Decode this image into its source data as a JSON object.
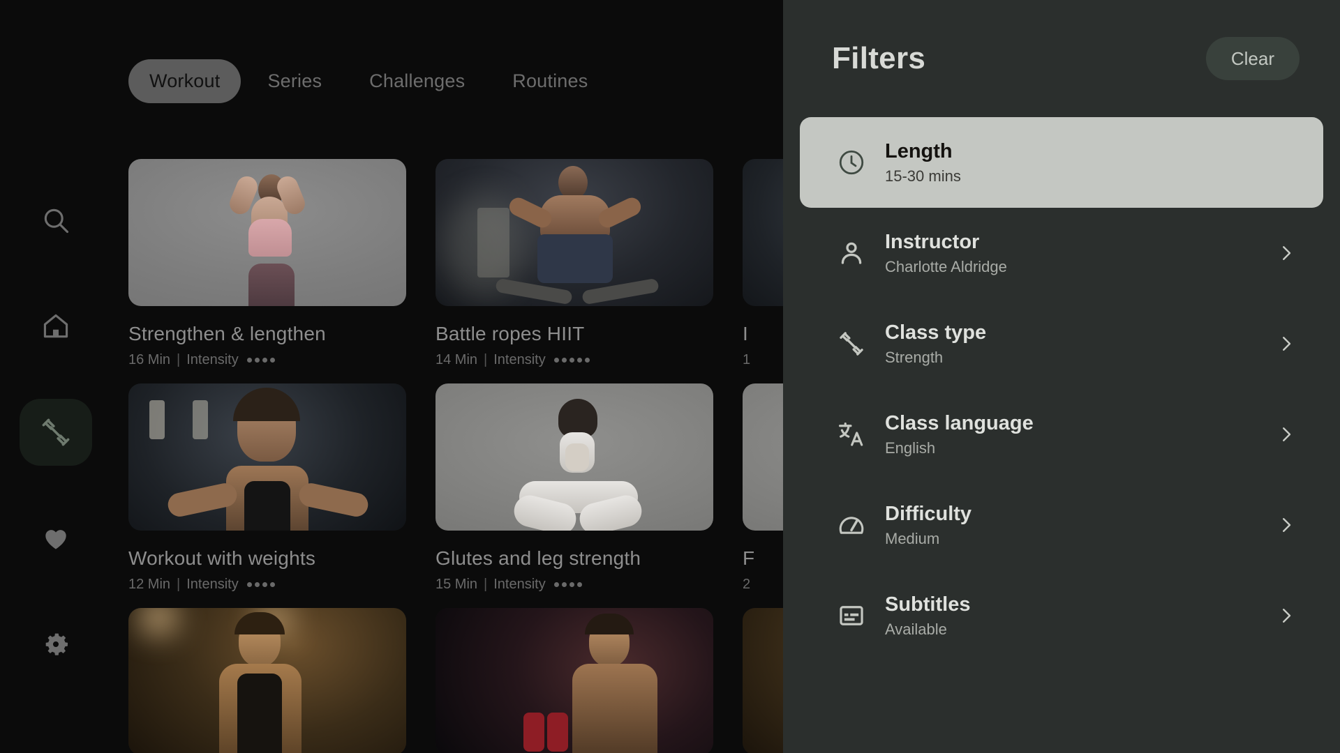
{
  "app": {
    "background_color": "#0b0b0b",
    "panel_color": "#2b2f2d",
    "selected_card_color": "#c4c7c2"
  },
  "sidebar": {
    "items": [
      {
        "icon": "search-icon",
        "active": false
      },
      {
        "icon": "home-icon",
        "active": false
      },
      {
        "icon": "dumbbell-icon",
        "active": true
      },
      {
        "icon": "heart-icon",
        "active": false
      },
      {
        "icon": "gear-icon",
        "active": false
      }
    ]
  },
  "tabs": [
    {
      "label": "Workout",
      "active": true
    },
    {
      "label": "Series",
      "active": false
    },
    {
      "label": "Challenges",
      "active": false
    },
    {
      "label": "Routines",
      "active": false
    }
  ],
  "cards": [
    {
      "title": "Strengthen & lengthen",
      "duration": "16 Min",
      "intensity_label": "Intensity",
      "intensity": 4,
      "scene": "sc-studio-gray"
    },
    {
      "title": "Battle ropes HIIT",
      "duration": "14 Min",
      "intensity_label": "Intensity",
      "intensity": 5,
      "scene": "sc-gym-dark"
    },
    {
      "title": "I",
      "duration": "1",
      "intensity_label": "",
      "intensity": 0,
      "scene": "sc-gym-cool"
    },
    {
      "title": "Workout with weights",
      "duration": "12 Min",
      "intensity_label": "Intensity",
      "intensity": 4,
      "scene": "sc-gym-cool"
    },
    {
      "title": "Glutes and leg strength",
      "duration": "15 Min",
      "intensity_label": "Intensity",
      "intensity": 4,
      "scene": "sc-studio-light"
    },
    {
      "title": "F",
      "duration": "2",
      "intensity_label": "",
      "intensity": 0,
      "scene": "sc-studio-light"
    },
    {
      "title": "",
      "duration": "",
      "intensity_label": "",
      "intensity": 0,
      "scene": "sc-gym-warm"
    },
    {
      "title": "",
      "duration": "",
      "intensity_label": "",
      "intensity": 0,
      "scene": "sc-gym-red"
    },
    {
      "title": "",
      "duration": "",
      "intensity_label": "",
      "intensity": 0,
      "scene": "sc-gym-warm"
    }
  ],
  "filters_panel": {
    "title": "Filters",
    "clear_label": "Clear",
    "rows": [
      {
        "icon": "clock-icon",
        "label": "Length",
        "value": "15-30 mins",
        "selected": true,
        "has_chevron": false
      },
      {
        "icon": "person-icon",
        "label": "Instructor",
        "value": "Charlotte Aldridge",
        "selected": false,
        "has_chevron": true
      },
      {
        "icon": "dumbbell-icon",
        "label": "Class type",
        "value": "Strength",
        "selected": false,
        "has_chevron": true
      },
      {
        "icon": "translate-icon",
        "label": "Class language",
        "value": "English",
        "selected": false,
        "has_chevron": true
      },
      {
        "icon": "gauge-icon",
        "label": "Difficulty",
        "value": "Medium",
        "selected": false,
        "has_chevron": true
      },
      {
        "icon": "subtitles-icon",
        "label": "Subtitles",
        "value": "Available",
        "selected": false,
        "has_chevron": true
      }
    ]
  }
}
